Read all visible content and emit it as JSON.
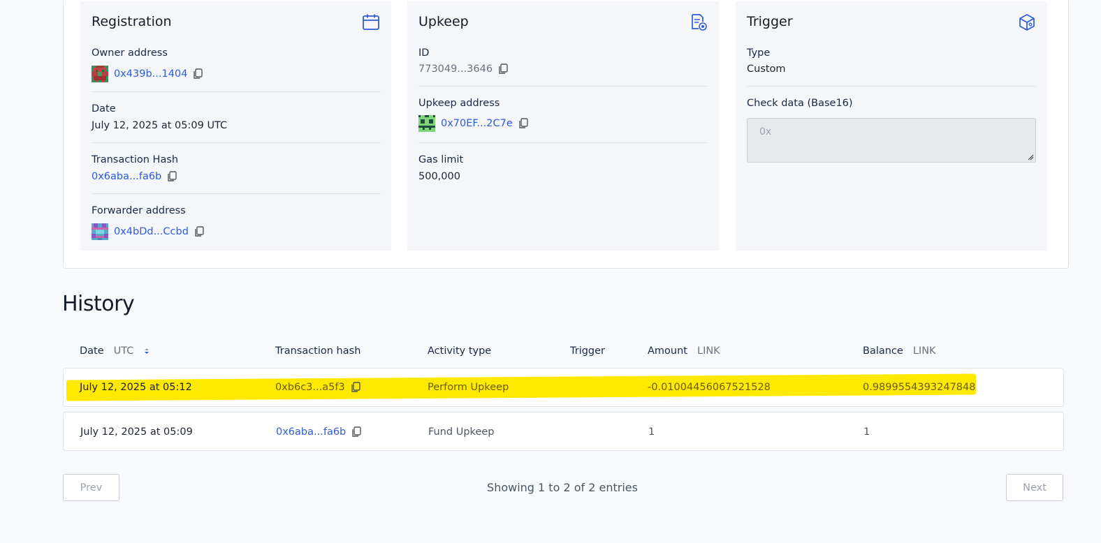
{
  "registration": {
    "title": "Registration",
    "owner_label": "Owner address",
    "owner_value": "0x439b...1404",
    "date_label": "Date",
    "date_value": "July 12, 2025 at 05:09 UTC",
    "tx_label": "Transaction Hash",
    "tx_value": "0x6aba...fa6b",
    "forwarder_label": "Forwarder address",
    "forwarder_value": "0x4bDd...Ccbd"
  },
  "upkeep": {
    "title": "Upkeep",
    "id_label": "ID",
    "id_value": "773049...3646",
    "address_label": "Upkeep address",
    "address_value": "0x70EF...2C7e",
    "gas_label": "Gas limit",
    "gas_value": "500,000"
  },
  "trigger": {
    "title": "Trigger",
    "type_label": "Type",
    "type_value": "Custom",
    "checkdata_label": "Check data (Base16)",
    "checkdata_placeholder": "0x"
  },
  "history": {
    "title": "History",
    "columns": {
      "date": "Date",
      "date_unit": "UTC",
      "tx": "Transaction hash",
      "activity": "Activity type",
      "trigger": "Trigger",
      "amount": "Amount",
      "amount_unit": "LINK",
      "balance": "Balance",
      "balance_unit": "LINK"
    },
    "rows": [
      {
        "date": "July 12, 2025 at 05:12",
        "tx": "0xb6c3...a5f3",
        "activity": "Perform Upkeep",
        "trigger": "",
        "amount": "-0.01004456067521528",
        "balance": "0.9899554393247848"
      },
      {
        "date": "July 12, 2025 at 05:09",
        "tx": "0x6aba...fa6b",
        "activity": "Fund Upkeep",
        "trigger": "",
        "amount": "1",
        "balance": "1"
      }
    ],
    "pagination": {
      "prev": "Prev",
      "next": "Next",
      "info": "Showing 1 to 2 of 2 entries"
    }
  },
  "colors": {
    "link": "#2e5bd9",
    "highlight": "#ffe900",
    "panel_bg": "#f4f6fa"
  },
  "icons": [
    "calendar-icon",
    "upkeep-doc-icon",
    "cube-icon",
    "copy-icon",
    "sort-icon"
  ]
}
